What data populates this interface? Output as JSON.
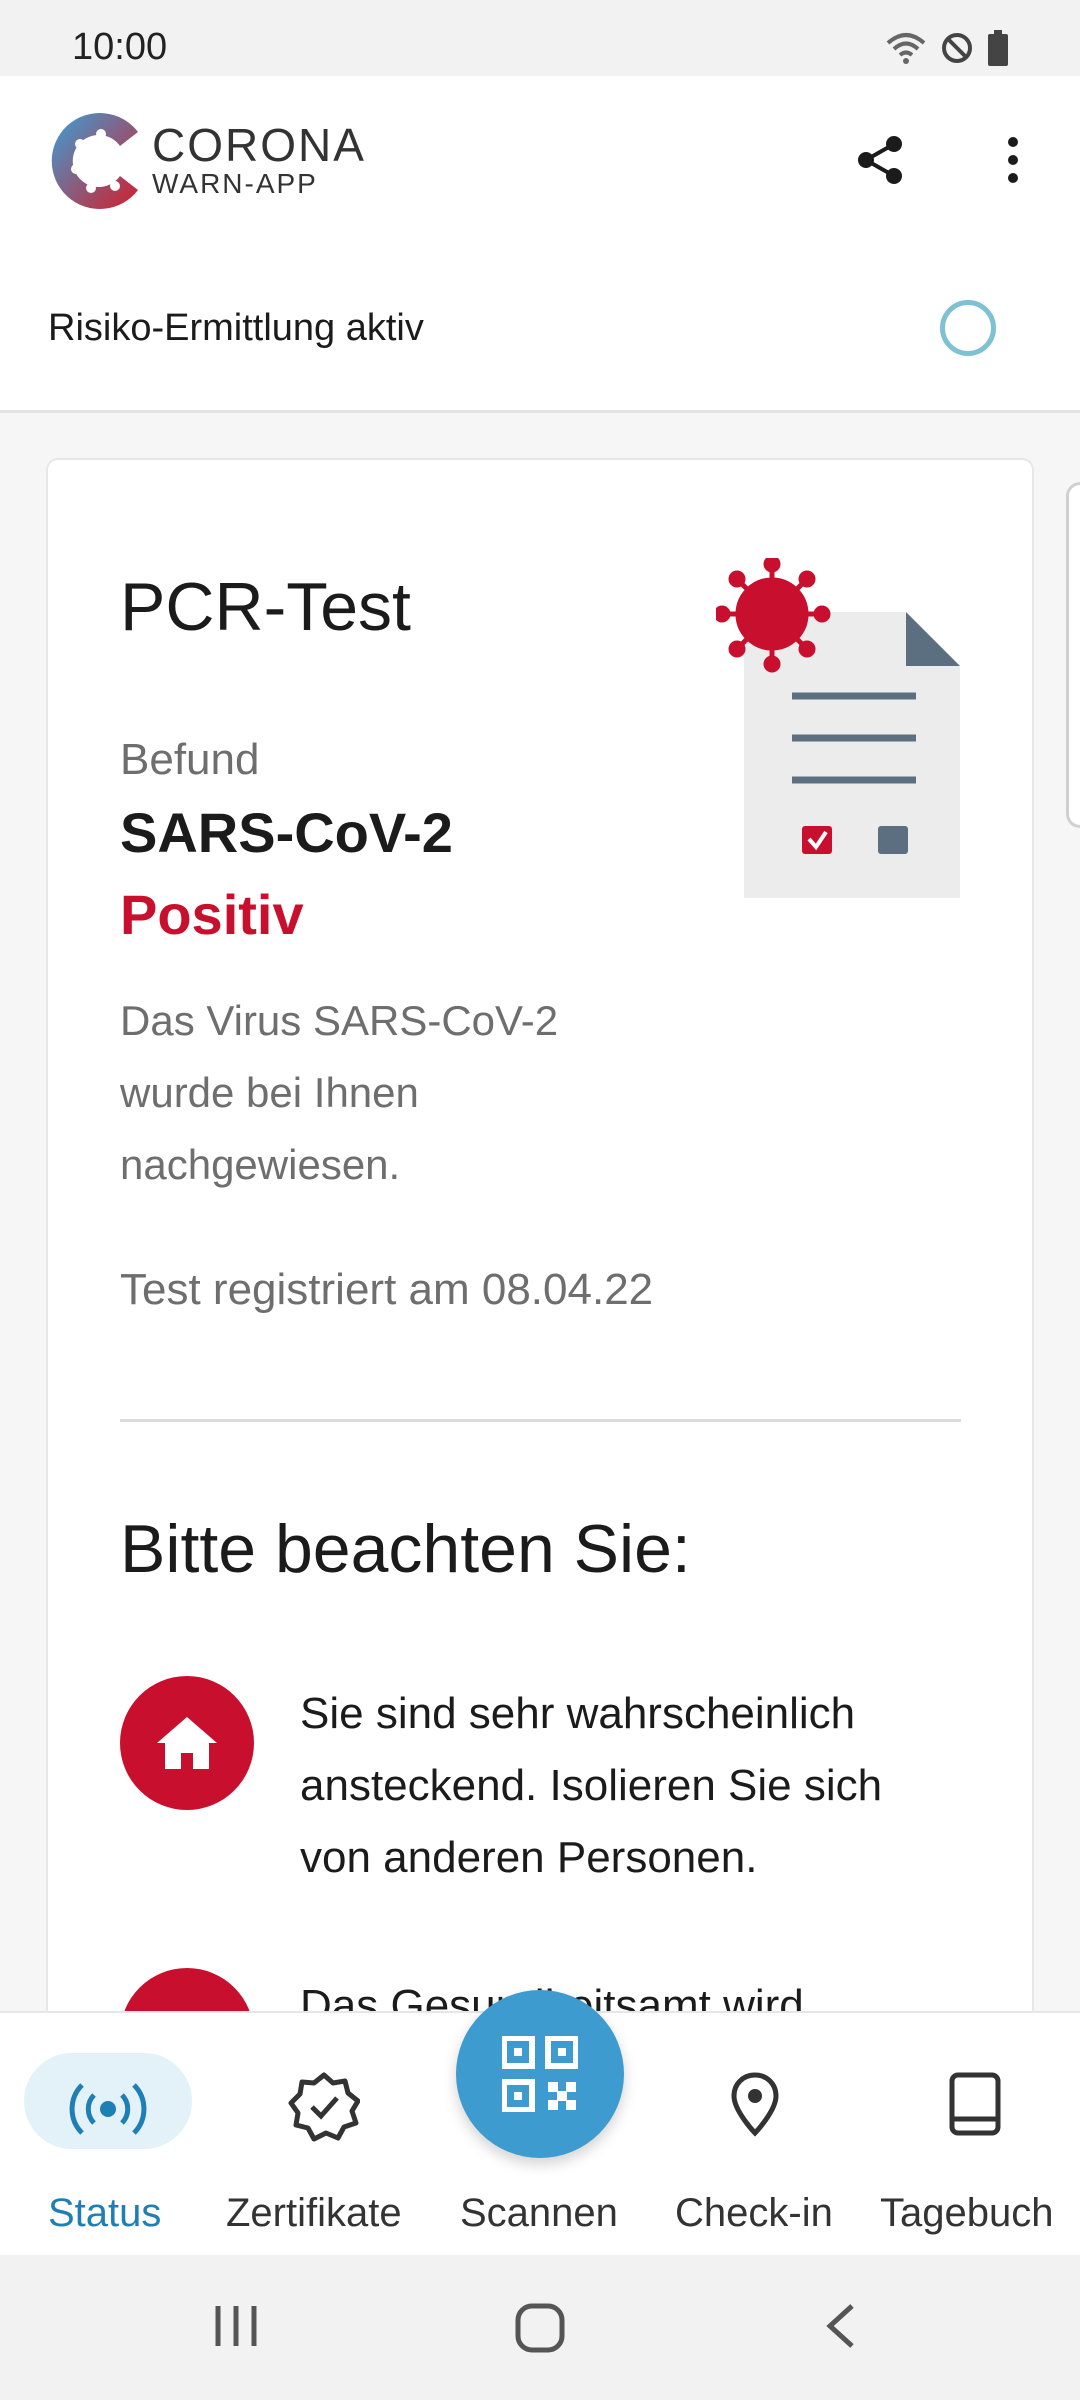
{
  "status_bar": {
    "time": "10:00"
  },
  "header": {
    "brand_title": "CORONA",
    "brand_subtitle": "WARN-APP",
    "risk_label": "Risiko-Ermittlung aktiv"
  },
  "card": {
    "test_title": "PCR-Test",
    "result_label": "Befund",
    "pathogen": "SARS-CoV-2",
    "result_value": "Positiv",
    "result_description": "Das Virus SARS-CoV-2 wurde bei Ihnen nachgewiesen.",
    "registered": "Test registriert am 08.04.22",
    "notice_heading": "Bitte beachten Sie:",
    "notices": [
      {
        "icon": "home-icon",
        "text": "Sie sind sehr wahrscheinlich ansteckend. Isolieren Sie sich von anderen Personen."
      },
      {
        "icon": "person-icon",
        "text": "Das Gesundheitsamt wird"
      }
    ]
  },
  "bottom_nav": {
    "items": [
      {
        "label": "Status",
        "icon": "radar-icon",
        "active": true
      },
      {
        "label": "Zertifikate",
        "icon": "certificate-badge-icon"
      },
      {
        "label": "Scannen",
        "icon": "qr-code-icon"
      },
      {
        "label": "Check-in",
        "icon": "location-pin-icon"
      },
      {
        "label": "Tagebuch",
        "icon": "book-icon"
      }
    ]
  },
  "colors": {
    "accent_red": "#c8102e",
    "accent_blue": "#3e9bd0",
    "active_blue": "#1e7fb5"
  }
}
